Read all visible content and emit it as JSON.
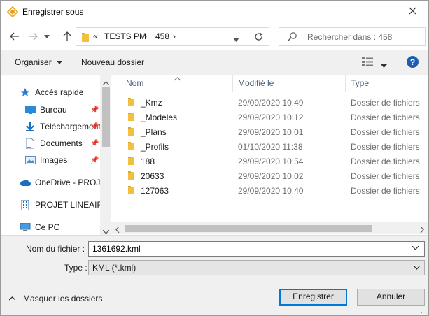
{
  "window": {
    "title": "Enregistrer sous"
  },
  "address": {
    "crumb_prefix": "«",
    "crumbs": [
      "TESTS PM",
      "458"
    ],
    "separator": "›"
  },
  "search": {
    "placeholder": "Rechercher dans : 458"
  },
  "toolbar": {
    "organize_label": "Organiser",
    "new_folder_label": "Nouveau dossier"
  },
  "nav": {
    "quick_access": "Accès rapide",
    "items": [
      {
        "label": "Bureau",
        "icon": "desktop-icon",
        "pinned": true
      },
      {
        "label": "Téléchargements",
        "icon": "download-icon",
        "pinned": true
      },
      {
        "label": "Documents",
        "icon": "document-icon",
        "pinned": true
      },
      {
        "label": "Images",
        "icon": "images-icon",
        "pinned": true
      }
    ],
    "onedrive": "OneDrive - PROJET",
    "projet": "PROJET LINEAIRE",
    "this_pc": "Ce PC"
  },
  "columns": {
    "name": "Nom",
    "modified": "Modifié le",
    "type": "Type"
  },
  "files": [
    {
      "name": "_Kmz",
      "modified": "29/09/2020 10:49",
      "type": "Dossier de fichiers"
    },
    {
      "name": "_Modeles",
      "modified": "29/09/2020 10:12",
      "type": "Dossier de fichiers"
    },
    {
      "name": "_Plans",
      "modified": "29/09/2020 10:01",
      "type": "Dossier de fichiers"
    },
    {
      "name": "_Profils",
      "modified": "01/10/2020 11:38",
      "type": "Dossier de fichiers"
    },
    {
      "name": "188",
      "modified": "29/09/2020 10:54",
      "type": "Dossier de fichiers"
    },
    {
      "name": "20633",
      "modified": "29/09/2020 10:02",
      "type": "Dossier de fichiers"
    },
    {
      "name": "127063",
      "modified": "29/09/2020 10:40",
      "type": "Dossier de fichiers"
    }
  ],
  "form": {
    "filename_label": "Nom du fichier :",
    "filename_value": "1361692.kml",
    "type_label": "Type :",
    "type_value": "KML (*.kml)"
  },
  "footer": {
    "hide_folders_label": "Masquer les dossiers",
    "save_label": "Enregistrer",
    "cancel_label": "Annuler"
  },
  "colors": {
    "accent": "#0078d7",
    "folder": "#f0c040",
    "help": "#1a5fb4"
  }
}
